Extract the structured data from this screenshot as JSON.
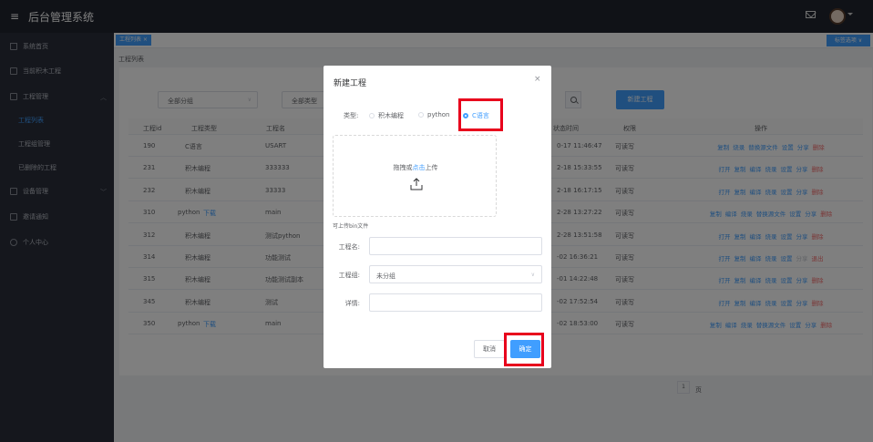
{
  "app": {
    "title": "后台管理系统",
    "menu_icon": "menu-icon",
    "mail_icon": "mail-icon"
  },
  "sidebar": {
    "items": [
      {
        "label": "系统首页",
        "icon": "home-icon"
      },
      {
        "label": "当前积木工程",
        "icon": "doc-icon"
      },
      {
        "label": "工程管理",
        "icon": "folder-icon"
      },
      {
        "label": "设备管理",
        "icon": "list-icon"
      },
      {
        "label": "邀请通知",
        "icon": "mail-icon"
      },
      {
        "label": "个人中心",
        "icon": "user-icon"
      }
    ],
    "project_sub": [
      "工程列表",
      "工程组管理",
      "已删除的工程"
    ]
  },
  "tabs": {
    "active": "工程列表 ×",
    "options": "标签选项 ∨"
  },
  "page": {
    "heading": "工程列表"
  },
  "filters": {
    "group": "全部分组",
    "type": "全部类型",
    "new_project": "新建工程"
  },
  "table": {
    "headers": [
      "工程id",
      "工程类型",
      "工程名",
      "状态时间",
      "权限",
      "操作"
    ],
    "rows": [
      {
        "id": "190",
        "type": "C语言",
        "type_link": "",
        "name": "USART",
        "time": "0-17 11:46:47",
        "perm": "可读写",
        "ops": [
          [
            "复制",
            "link"
          ],
          [
            "烧录",
            "link"
          ],
          [
            "替换源文件",
            "link"
          ],
          [
            "设置",
            "link"
          ],
          [
            "分享",
            "link"
          ],
          [
            "删除",
            "danger"
          ]
        ]
      },
      {
        "id": "231",
        "type": "积木编程",
        "type_link": "",
        "name": "333333",
        "time": "2-18 15:33:55",
        "perm": "可读写",
        "ops": [
          [
            "打开",
            "link"
          ],
          [
            "复制",
            "link"
          ],
          [
            "编译",
            "link"
          ],
          [
            "烧录",
            "link"
          ],
          [
            "设置",
            "link"
          ],
          [
            "分享",
            "link"
          ],
          [
            "删除",
            "danger"
          ]
        ]
      },
      {
        "id": "232",
        "type": "积木编程",
        "type_link": "",
        "name": "33333",
        "time": "2-18 16:17:15",
        "perm": "可读写",
        "ops": [
          [
            "打开",
            "link"
          ],
          [
            "复制",
            "link"
          ],
          [
            "编译",
            "link"
          ],
          [
            "烧录",
            "link"
          ],
          [
            "设置",
            "link"
          ],
          [
            "分享",
            "link"
          ],
          [
            "删除",
            "danger"
          ]
        ]
      },
      {
        "id": "310",
        "type": "python",
        "type_link": "下载",
        "name": "main",
        "time": "2-28 13:27:22",
        "perm": "可读写",
        "ops": [
          [
            "复制",
            "link"
          ],
          [
            "编译",
            "link"
          ],
          [
            "烧录",
            "link"
          ],
          [
            "替换源文件",
            "link"
          ],
          [
            "设置",
            "link"
          ],
          [
            "分享",
            "link"
          ],
          [
            "删除",
            "danger"
          ]
        ]
      },
      {
        "id": "312",
        "type": "积木编程",
        "type_link": "",
        "name": "测试python",
        "time": "2-28 13:51:58",
        "perm": "可读写",
        "ops": [
          [
            "打开",
            "link"
          ],
          [
            "复制",
            "link"
          ],
          [
            "编译",
            "link"
          ],
          [
            "烧录",
            "link"
          ],
          [
            "设置",
            "link"
          ],
          [
            "分享",
            "link"
          ],
          [
            "删除",
            "danger"
          ]
        ]
      },
      {
        "id": "314",
        "type": "积木编程",
        "type_link": "",
        "name": "功能测试",
        "time": "-02 16:36:21",
        "perm": "可读写",
        "ops": [
          [
            "打开",
            "link"
          ],
          [
            "复制",
            "link"
          ],
          [
            "编译",
            "link"
          ],
          [
            "烧录",
            "link"
          ],
          [
            "设置",
            "link"
          ],
          [
            "分享",
            "muted"
          ],
          [
            "退出",
            "danger"
          ]
        ]
      },
      {
        "id": "315",
        "type": "积木编程",
        "type_link": "",
        "name": "功能测试副本",
        "time": "-01 14:22:48",
        "perm": "可读写",
        "ops": [
          [
            "打开",
            "link"
          ],
          [
            "复制",
            "link"
          ],
          [
            "编译",
            "link"
          ],
          [
            "烧录",
            "link"
          ],
          [
            "设置",
            "link"
          ],
          [
            "分享",
            "link"
          ],
          [
            "删除",
            "danger"
          ]
        ]
      },
      {
        "id": "345",
        "type": "积木编程",
        "type_link": "",
        "name": "测试",
        "time": "-02 17:52:54",
        "perm": "可读写",
        "ops": [
          [
            "打开",
            "link"
          ],
          [
            "复制",
            "link"
          ],
          [
            "编译",
            "link"
          ],
          [
            "烧录",
            "link"
          ],
          [
            "设置",
            "link"
          ],
          [
            "分享",
            "link"
          ],
          [
            "删除",
            "danger"
          ]
        ]
      },
      {
        "id": "350",
        "type": "python",
        "type_link": "下载",
        "name": "main",
        "time": "-02 18:53:00",
        "perm": "可读写",
        "ops": [
          [
            "复制",
            "link"
          ],
          [
            "编译",
            "link"
          ],
          [
            "烧录",
            "link"
          ],
          [
            "替换源文件",
            "link"
          ],
          [
            "设置",
            "link"
          ],
          [
            "分享",
            "link"
          ],
          [
            "删除",
            "danger"
          ]
        ]
      }
    ]
  },
  "pager": {
    "page": "1",
    "suffix": "页"
  },
  "modal": {
    "title": "新建工程",
    "close": "×",
    "type_label": "类型:",
    "types": [
      {
        "label": "积木编程",
        "checked": false
      },
      {
        "label": "python",
        "checked": false
      },
      {
        "label": "C语言",
        "checked": true
      }
    ],
    "upload_text_pre": "拖拽或",
    "upload_text_link": "点击",
    "upload_text_post": "上传",
    "upload_tip": "可上传bin文件",
    "name_label": "工程名:",
    "name_value": "",
    "group_label": "工程组:",
    "group_value": "未分组",
    "detail_label": "详情:",
    "detail_value": "",
    "cancel": "取消",
    "confirm": "确定"
  },
  "colors": {
    "accent": "#409eff",
    "highlight": "#e8001c",
    "danger": "#f56c6c"
  }
}
